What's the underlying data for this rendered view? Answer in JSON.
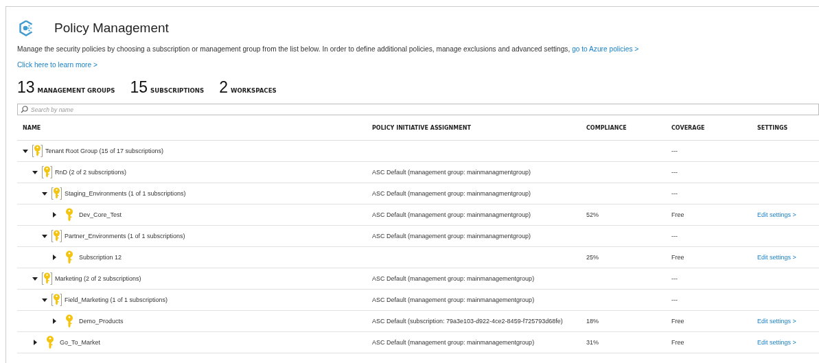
{
  "header": {
    "title": "Policy Management",
    "description": "Manage the security policies by choosing a subscription or management group from the list below. In order to define additional policies, manage exclusions and advanced settings,",
    "description_link": "go to Azure policies >",
    "learn_more": "Click here to learn more >"
  },
  "counts": [
    {
      "value": "13",
      "label": "MANAGEMENT GROUPS"
    },
    {
      "value": "15",
      "label": "SUBSCRIPTIONS"
    },
    {
      "value": "2",
      "label": "WORKSPACES"
    }
  ],
  "search": {
    "placeholder": "Search by name"
  },
  "table": {
    "columns": [
      "NAME",
      "POLICY INITIATIVE ASSIGNMENT",
      "COMPLIANCE",
      "COVERAGE",
      "SETTINGS"
    ],
    "rows": [
      {
        "kind": "group",
        "name": "Tenant Root Group (15 of 17 subscriptions)",
        "expanded": true,
        "coverage": "---",
        "children": [
          {
            "kind": "group",
            "name": "RnD (2 of 2 subscriptions)",
            "expanded": true,
            "assignment": "ASC Default (management group: mainmanagmentgroup)",
            "coverage": "---",
            "children": [
              {
                "kind": "group",
                "name": "Staging_Environments (1 of 1 subscriptions)",
                "expanded": true,
                "assignment": "ASC Default (management group: mainmanagmentgroup)",
                "coverage": "---",
                "children": [
                  {
                    "kind": "subscription",
                    "name": "Dev_Core_Test",
                    "expanded": false,
                    "assignment": "ASC Default (management group: mainmanagmentgroup)",
                    "compliance": "52%",
                    "coverage": "Free",
                    "settings": "Edit settings >"
                  }
                ]
              },
              {
                "kind": "group",
                "name": "Partner_Environments (1 of 1 subscriptions)",
                "expanded": true,
                "assignment": "ASC Default (management group: mainmanagmentgroup)",
                "coverage": "---",
                "children": [
                  {
                    "kind": "subscription",
                    "name": "Subscription 12",
                    "expanded": false,
                    "compliance": "25%",
                    "coverage": "Free",
                    "settings": "Edit settings >"
                  }
                ]
              }
            ]
          },
          {
            "kind": "group",
            "name": "Marketing (2 of 2 subscriptions)",
            "expanded": true,
            "assignment": "ASC Default (management group: mainmanagementgroup)",
            "coverage": "---",
            "children": [
              {
                "kind": "group",
                "name": "Field_Marketing (1 of 1 subscriptions)",
                "expanded": true,
                "assignment": "ASC Default (management group: mainmanagementgroup)",
                "coverage": "---",
                "children": [
                  {
                    "kind": "subscription",
                    "name": "Demo_Products",
                    "expanded": false,
                    "assignment": "ASC Default (subscription: 79a3e103-d922-4ce2-8459-f725793d68fe)",
                    "compliance": "18%",
                    "coverage": "Free",
                    "settings": "Edit settings >"
                  }
                ]
              }
            ]
          },
          {
            "kind": "subscription",
            "name": "Go_To_Market",
            "expanded": false,
            "assignment": "ASC Default (management group: mainmanagementgroup)",
            "compliance": "31%",
            "coverage": "Free",
            "settings": "Edit settings >"
          }
        ]
      }
    ]
  }
}
